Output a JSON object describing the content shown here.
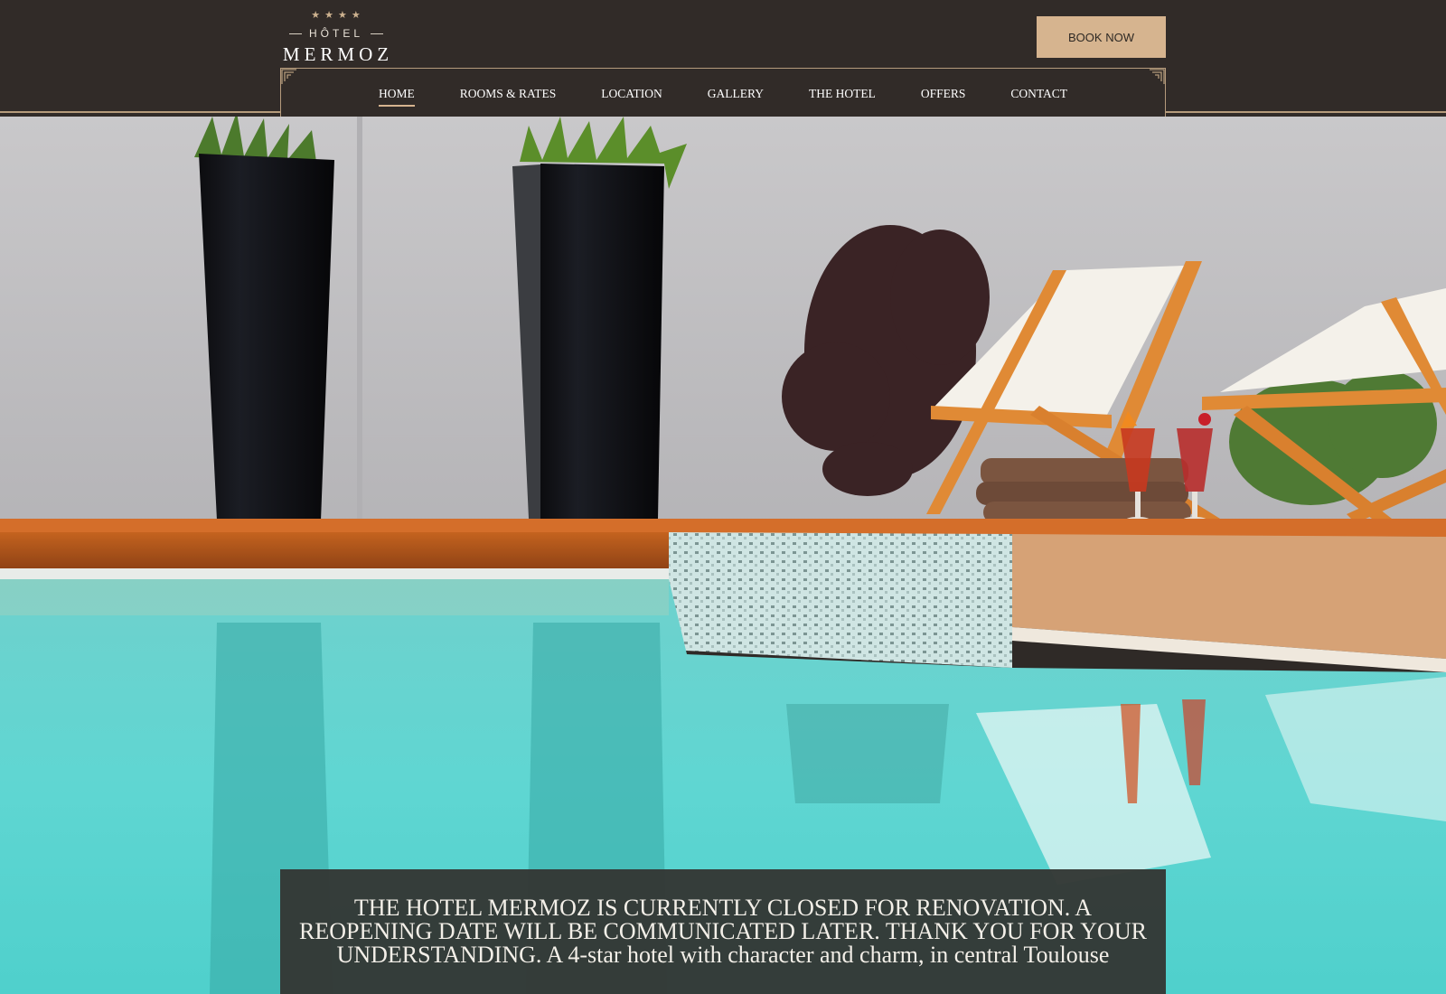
{
  "header": {
    "logo": {
      "stars": "★★★★",
      "hotel": "HÔTEL",
      "name": "MERMOZ"
    },
    "book_label": "BOOK NOW"
  },
  "nav": {
    "items": [
      {
        "label": "HOME",
        "active": true
      },
      {
        "label": "ROOMS & RATES"
      },
      {
        "label": "LOCATION"
      },
      {
        "label": "GALLERY"
      },
      {
        "label": "THE HOTEL"
      },
      {
        "label": "OFFERS"
      },
      {
        "label": "CONTACT"
      }
    ]
  },
  "hero": {
    "notice": "THE HOTEL MERMOZ IS CURRENTLY CLOSED FOR RENOVATION. A REOPENING DATE WILL BE COMMUNICATED LATER. THANK YOU FOR YOUR UNDERSTANDING. A 4-star hotel with character and charm, in central Toulouse"
  },
  "colors": {
    "header_bg": "#312b28",
    "accent_gold": "#d6b48f",
    "pool_water": "#5fd6d2",
    "notice_bg": "#343835"
  }
}
